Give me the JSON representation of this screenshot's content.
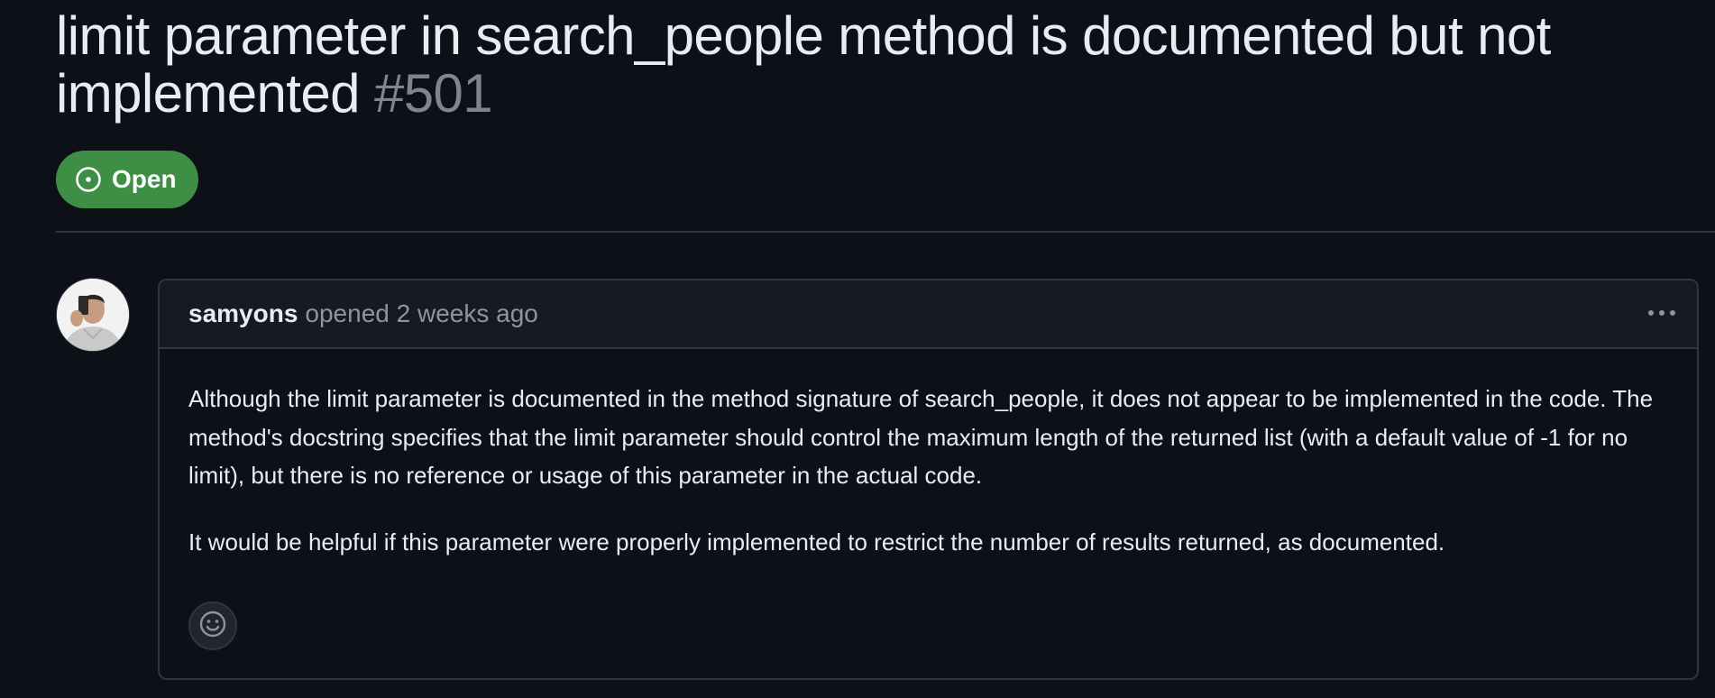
{
  "issue": {
    "title": "limit parameter in search_people method is documented but not implemented",
    "number": "#501",
    "state": "Open",
    "state_color": "#3f8e45"
  },
  "comment": {
    "author": "samyons",
    "opened_text": "opened 2 weeks ago",
    "paragraphs": [
      "Although the limit parameter is documented in the method signature of search_people, it does not appear to be implemented in the code. The method's docstring specifies that the limit parameter should control the maximum length of the returned list (with a default value of -1 for no limit), but there is no reference or usage of this parameter in the actual code.",
      "It would be helpful if this parameter were properly implemented to restrict the number of results returned, as documented."
    ]
  },
  "icons": {
    "state": "issue-opened-icon",
    "more": "kebab-horizontal-icon",
    "reaction": "smiley-icon",
    "avatar": "user-avatar"
  },
  "colors": {
    "background": "#0d1117",
    "header_background": "#161b22",
    "border": "#30363d",
    "muted_text": "#7d8590"
  }
}
